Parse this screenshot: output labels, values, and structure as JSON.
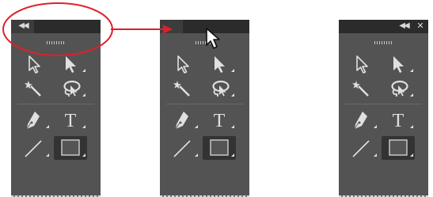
{
  "panels": [
    {
      "variant": "collapse-button-on-left",
      "titlebar_left_glyph": "◀◀",
      "titlebar_right_glyphs": [],
      "tools": [
        {
          "icon": "selection-arrow-icon",
          "active": false
        },
        {
          "icon": "direct-selection-arrow-icon",
          "active": false
        },
        {
          "icon": "magic-wand-icon",
          "active": false
        },
        {
          "icon": "lasso-icon",
          "active": false
        },
        {
          "icon": "pen-tool-icon",
          "active": false
        },
        {
          "icon": "type-tool-icon",
          "active": false
        },
        {
          "icon": "line-segment-icon",
          "active": false
        },
        {
          "icon": "rectangle-tool-icon",
          "active": true
        }
      ]
    },
    {
      "variant": "dragging-titlebar",
      "titlebar_left_glyph": "",
      "titlebar_right_glyphs": [],
      "tools": [
        {
          "icon": "selection-arrow-icon",
          "active": false
        },
        {
          "icon": "direct-selection-arrow-icon",
          "active": false
        },
        {
          "icon": "magic-wand-icon",
          "active": false
        },
        {
          "icon": "lasso-icon",
          "active": false
        },
        {
          "icon": "pen-tool-icon",
          "active": false
        },
        {
          "icon": "type-tool-icon",
          "active": false
        },
        {
          "icon": "line-segment-icon",
          "active": false
        },
        {
          "icon": "rectangle-tool-icon",
          "active": true
        }
      ]
    },
    {
      "variant": "floating-panel",
      "titlebar_left_glyph": "",
      "titlebar_right_glyphs": [
        "◀◀",
        "✕"
      ],
      "tools": [
        {
          "icon": "selection-arrow-icon",
          "active": false
        },
        {
          "icon": "direct-selection-arrow-icon",
          "active": false
        },
        {
          "icon": "magic-wand-icon",
          "active": false
        },
        {
          "icon": "lasso-icon",
          "active": false
        },
        {
          "icon": "pen-tool-icon",
          "active": false
        },
        {
          "icon": "type-tool-icon",
          "active": false
        },
        {
          "icon": "line-segment-icon",
          "active": false
        },
        {
          "icon": "rectangle-tool-icon",
          "active": true
        }
      ]
    }
  ],
  "type_tool_glyph": "T",
  "colors": {
    "panel_bg": "#535353",
    "titlebar_bg": "#2b2b2b",
    "icon": "#e0e0e0",
    "active_tool_bg": "#333333",
    "callout": "#e0202a"
  }
}
